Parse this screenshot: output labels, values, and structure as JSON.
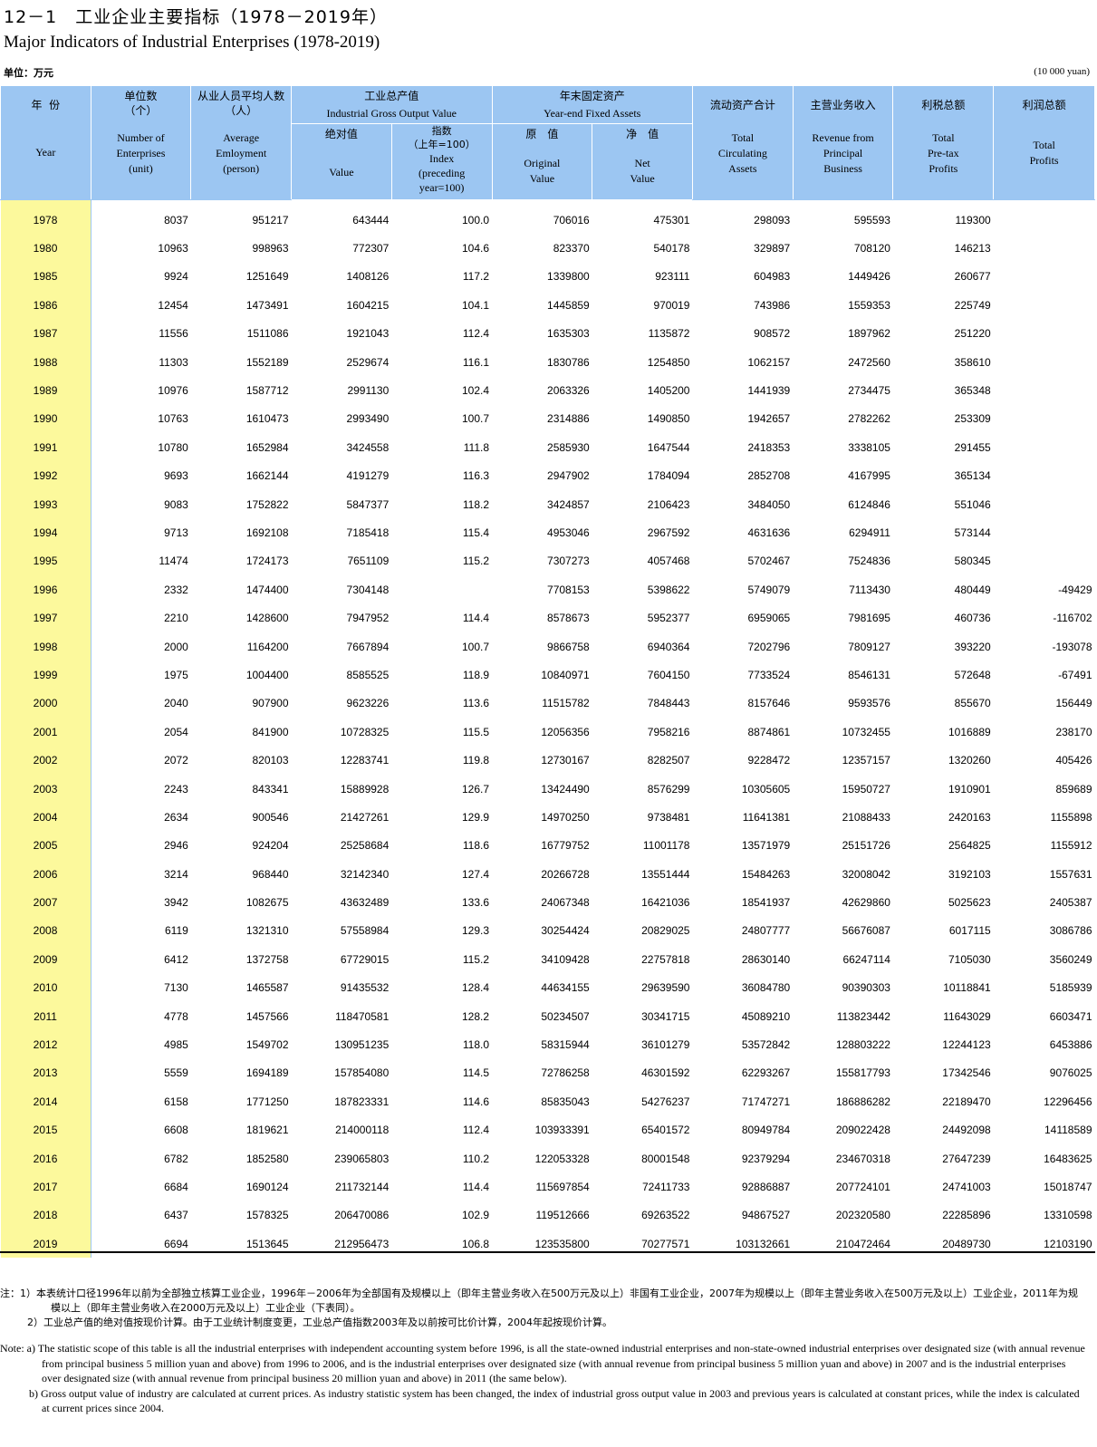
{
  "title_cn": "12－1　工业企业主要指标（1978－2019年）",
  "title_en": "Major Indicators of Industrial Enterprises (1978-2019)",
  "unit_cn": "单位：万元",
  "unit_en": "(10 000 yuan)",
  "header": {
    "year_cn": "年  份",
    "year_en": "Year",
    "enterprises_cn": "单位数\n（个）",
    "enterprises_en": "Number of\nEnterprises\n(unit)",
    "employment_cn": "从业人员平均人数\n（人）",
    "employment_en": "Average\nEmloyment\n(person)",
    "gross_output_cn": "工业总产值",
    "gross_output_en": "Industrial Gross Output Value",
    "abs_value_cn": "绝对值",
    "abs_value_en": "Value",
    "index_cn": "指数\n（上年=100）",
    "index_en": "Index\n(preceding\nyear=100)",
    "fixed_assets_cn": "年末固定资产",
    "fixed_assets_en": "Year-end Fixed Assets",
    "original_cn": "原　值",
    "original_en": "Original\nValue",
    "net_cn": "净　值",
    "net_en": "Net\nValue",
    "circulating_cn": "流动资产合计",
    "circulating_en": "Total\nCirculating\nAssets",
    "revenue_cn": "主营业务收入",
    "revenue_en": "Revenue from\nPrincipal\nBusiness",
    "pretax_cn": "利税总额",
    "pretax_en": "Total\nPre-tax\nProfits",
    "profits_cn": "利润总额",
    "profits_en": "Total\nProfits"
  },
  "rows": [
    [
      "1978",
      "8037",
      "951217",
      "643444",
      "100.0",
      "706016",
      "475301",
      "298093",
      "595593",
      "119300",
      ""
    ],
    [
      "1980",
      "10963",
      "998963",
      "772307",
      "104.6",
      "823370",
      "540178",
      "329897",
      "708120",
      "146213",
      ""
    ],
    [
      "1985",
      "9924",
      "1251649",
      "1408126",
      "117.2",
      "1339800",
      "923111",
      "604983",
      "1449426",
      "260677",
      ""
    ],
    [
      "1986",
      "12454",
      "1473491",
      "1604215",
      "104.1",
      "1445859",
      "970019",
      "743986",
      "1559353",
      "225749",
      ""
    ],
    [
      "1987",
      "11556",
      "1511086",
      "1921043",
      "112.4",
      "1635303",
      "1135872",
      "908572",
      "1897962",
      "251220",
      ""
    ],
    [
      "1988",
      "11303",
      "1552189",
      "2529674",
      "116.1",
      "1830786",
      "1254850",
      "1062157",
      "2472560",
      "358610",
      ""
    ],
    [
      "1989",
      "10976",
      "1587712",
      "2991130",
      "102.4",
      "2063326",
      "1405200",
      "1441939",
      "2734475",
      "365348",
      ""
    ],
    [
      "1990",
      "10763",
      "1610473",
      "2993490",
      "100.7",
      "2314886",
      "1490850",
      "1942657",
      "2782262",
      "253309",
      ""
    ],
    [
      "1991",
      "10780",
      "1652984",
      "3424558",
      "111.8",
      "2585930",
      "1647544",
      "2418353",
      "3338105",
      "291455",
      ""
    ],
    [
      "1992",
      "9693",
      "1662144",
      "4191279",
      "116.3",
      "2947902",
      "1784094",
      "2852708",
      "4167995",
      "365134",
      ""
    ],
    [
      "1993",
      "9083",
      "1752822",
      "5847377",
      "118.2",
      "3424857",
      "2106423",
      "3484050",
      "6124846",
      "551046",
      ""
    ],
    [
      "1994",
      "9713",
      "1692108",
      "7185418",
      "115.4",
      "4953046",
      "2967592",
      "4631636",
      "6294911",
      "573144",
      ""
    ],
    [
      "1995",
      "11474",
      "1724173",
      "7651109",
      "115.2",
      "7307273",
      "4057468",
      "5702467",
      "7524836",
      "580345",
      ""
    ],
    [
      "1996",
      "2332",
      "1474400",
      "7304148",
      "",
      "7708153",
      "5398622",
      "5749079",
      "7113430",
      "480449",
      "-49429"
    ],
    [
      "1997",
      "2210",
      "1428600",
      "7947952",
      "114.4",
      "8578673",
      "5952377",
      "6959065",
      "7981695",
      "460736",
      "-116702"
    ],
    [
      "1998",
      "2000",
      "1164200",
      "7667894",
      "100.7",
      "9866758",
      "6940364",
      "7202796",
      "7809127",
      "393220",
      "-193078"
    ],
    [
      "1999",
      "1975",
      "1004400",
      "8585525",
      "118.9",
      "10840971",
      "7604150",
      "7733524",
      "8546131",
      "572648",
      "-67491"
    ],
    [
      "2000",
      "2040",
      "907900",
      "9623226",
      "113.6",
      "11515782",
      "7848443",
      "8157646",
      "9593576",
      "855670",
      "156449"
    ],
    [
      "2001",
      "2054",
      "841900",
      "10728325",
      "115.5",
      "12056356",
      "7958216",
      "8874861",
      "10732455",
      "1016889",
      "238170"
    ],
    [
      "2002",
      "2072",
      "820103",
      "12283741",
      "119.8",
      "12730167",
      "8282507",
      "9228472",
      "12357157",
      "1320260",
      "405426"
    ],
    [
      "2003",
      "2243",
      "843341",
      "15889928",
      "126.7",
      "13424490",
      "8576299",
      "10305605",
      "15950727",
      "1910901",
      "859689"
    ],
    [
      "2004",
      "2634",
      "900546",
      "21427261",
      "129.9",
      "14970250",
      "9738481",
      "11641381",
      "21088433",
      "2420163",
      "1155898"
    ],
    [
      "2005",
      "2946",
      "924204",
      "25258684",
      "118.6",
      "16779752",
      "11001178",
      "13571979",
      "25151726",
      "2564825",
      "1155912"
    ],
    [
      "2006",
      "3214",
      "968440",
      "32142340",
      "127.4",
      "20266728",
      "13551444",
      "15484263",
      "32008042",
      "3192103",
      "1557631"
    ],
    [
      "2007",
      "3942",
      "1082675",
      "43632489",
      "133.6",
      "24067348",
      "16421036",
      "18541937",
      "42629860",
      "5025623",
      "2405387"
    ],
    [
      "2008",
      "6119",
      "1321310",
      "57558984",
      "129.3",
      "30254424",
      "20829025",
      "24807777",
      "56676087",
      "6017115",
      "3086786"
    ],
    [
      "2009",
      "6412",
      "1372758",
      "67729015",
      "115.2",
      "34109428",
      "22757818",
      "28630140",
      "66247114",
      "7105030",
      "3560249"
    ],
    [
      "2010",
      "7130",
      "1465587",
      "91435532",
      "128.4",
      "44634155",
      "29639590",
      "36084780",
      "90390303",
      "10118841",
      "5185939"
    ],
    [
      "2011",
      "4778",
      "1457566",
      "118470581",
      "128.2",
      "50234507",
      "30341715",
      "45089210",
      "113823442",
      "11643029",
      "6603471"
    ],
    [
      "2012",
      "4985",
      "1549702",
      "130951235",
      "118.0",
      "58315944",
      "36101279",
      "53572842",
      "128803222",
      "12244123",
      "6453886"
    ],
    [
      "2013",
      "5559",
      "1694189",
      "157854080",
      "114.5",
      "72786258",
      "46301592",
      "62293267",
      "155817793",
      "17342546",
      "9076025"
    ],
    [
      "2014",
      "6158",
      "1771250",
      "187823331",
      "114.6",
      "85835043",
      "54276237",
      "71747271",
      "186886282",
      "22189470",
      "12296456"
    ],
    [
      "2015",
      "6608",
      "1819621",
      "214000118",
      "112.4",
      "103933391",
      "65401572",
      "80949784",
      "209022428",
      "24492098",
      "14118589"
    ],
    [
      "2016",
      "6782",
      "1852580",
      "239065803",
      "110.2",
      "122053328",
      "80001548",
      "92379294",
      "234670318",
      "27647239",
      "16483625"
    ],
    [
      "2017",
      "6684",
      "1690124",
      "211732144",
      "114.4",
      "115697854",
      "72411733",
      "92886887",
      "207724101",
      "24741003",
      "15018747"
    ],
    [
      "2018",
      "6437",
      "1578325",
      "206470086",
      "102.9",
      "119512666",
      "69263522",
      "94867527",
      "202320580",
      "22285896",
      "13310598"
    ],
    [
      "2019",
      "6694",
      "1513645",
      "212956473",
      "106.8",
      "123535800",
      "70277571",
      "103132661",
      "210472464",
      "20489730",
      "12103190"
    ]
  ],
  "notes": {
    "cn_1": "注：1）本表统计口径1996年以前为全部独立核算工业企业，1996年－2006年为全部国有及规模以上（即年主营业务收入在500万元及以上）非国有工业企业，2007年为规模以上（即年主营业务收入在500万元及以上）工业企业，2011年为规模以上（即年主营业务收入在2000万元及以上）工业企业（下表同）。",
    "cn_2": "2）工业总产值的绝对值按现价计算。由于工业统计制度变更，工业总产值指数2003年及以前按可比价计算，2004年起按现价计算。",
    "en_a": "Note: a) The statistic scope of this table is all the industrial enterprises with independent accounting system before 1996, is all the state-owned industrial enterprises and non-state-owned industrial enterprises over designated size (with annual revenue from principal business 5 million yuan and above) from 1996 to 2006, and is the industrial enterprises over designated size (with annual revenue from principal business 5 million yuan and above) in 2007 and is the industrial enterprises over designated size (with annual revenue from principal business 20 million yuan and above) in 2011 (the same below).",
    "en_b": "b) Gross output value of industry are calculated at current prices. As industry statistic system has been changed, the index of industrial gross output value in 2003 and previous years is calculated at constant prices, while the index is calculated at current prices since 2004."
  }
}
